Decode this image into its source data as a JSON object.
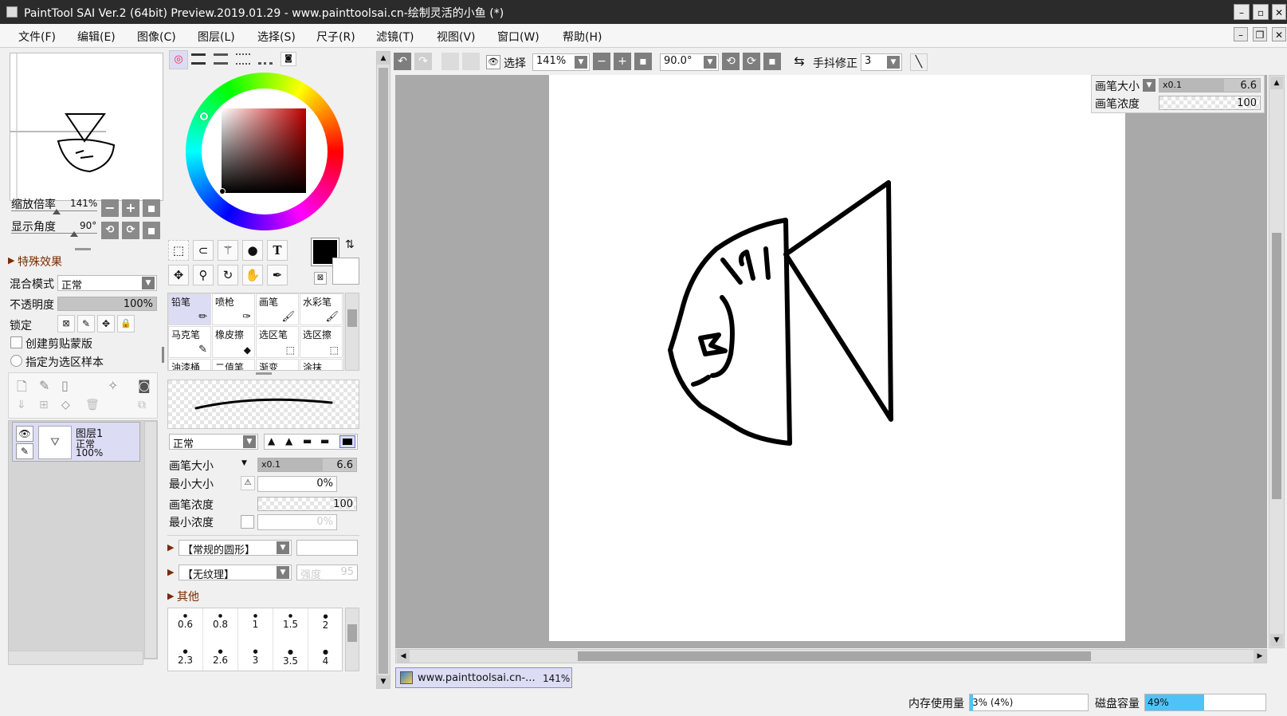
{
  "window": {
    "title": "PaintTool SAI Ver.2 (64bit) Preview.2019.01.29 - www.painttoolsai.cn-绘制灵活的小鱼 (*)"
  },
  "menu": [
    "文件(F)",
    "编辑(E)",
    "图像(C)",
    "图层(L)",
    "选择(S)",
    "尺子(R)",
    "滤镜(T)",
    "视图(V)",
    "窗口(W)",
    "帮助(H)"
  ],
  "navigator": {
    "zoom_label": "缩放倍率",
    "zoom_value": "141%",
    "angle_label": "显示角度",
    "angle_value": "90°"
  },
  "layer_props": {
    "effects_label": "特殊效果",
    "blend_label": "混合模式",
    "blend_value": "正常",
    "opacity_label": "不透明度",
    "opacity_value": "100%",
    "opacity_fraction": 1.0,
    "lock_label": "锁定",
    "clip_label": "创建剪贴蒙版",
    "sample_label": "指定为选区样本"
  },
  "layers": [
    {
      "name": "图层1",
      "mode": "正常",
      "opacity": "100%"
    }
  ],
  "tools": {
    "brushes_row1": [
      "铅笔",
      "喷枪",
      "画笔",
      "水彩笔"
    ],
    "brushes_row2": [
      "马克笔",
      "橡皮擦",
      "选区笔",
      "选区擦"
    ],
    "brushes_row3": [
      "油漆桶",
      "二值笔",
      "渐变",
      "涂抹"
    ],
    "text_tool_glyph": "T"
  },
  "brush_settings": {
    "mode_value": "正常",
    "size_label": "画笔大小",
    "size_mult": "x0.1",
    "size_value": "6.6",
    "min_size_label": "最小大小",
    "min_size_value": "0%",
    "density_label": "画笔浓度",
    "density_value": "100",
    "min_density_label": "最小浓度",
    "min_density_value": "0%",
    "shape_value": "【常规的圆形】",
    "texture_value": "【无纹理】",
    "texture_strength_label": "强度",
    "texture_strength_value": "95",
    "other_label": "其他",
    "size_presets_row1": [
      "0.6",
      "0.8",
      "1",
      "1.5",
      "2"
    ],
    "size_presets_row2": [
      "2.3",
      "2.6",
      "3",
      "3.5",
      "4"
    ]
  },
  "canvas_toolbar": {
    "select_label": "选择",
    "zoom_value": "141%",
    "rotation_value": "90.0°",
    "stabilizer_label": "手抖修正",
    "stabilizer_value": "3"
  },
  "canvas_overlay": {
    "size_label": "画笔大小",
    "size_mult": "x0.1",
    "size_value": "6.6",
    "density_label": "画笔浓度",
    "density_value": "100"
  },
  "document_tab": {
    "name": "www.painttoolsai.cn-...",
    "zoom": "141%"
  },
  "status": {
    "memory_label": "内存使用量",
    "memory_value": "3% (4%)",
    "memory_fraction": 0.03,
    "disk_label": "磁盘容量",
    "disk_value": "49%",
    "disk_fraction": 0.49
  },
  "colors": {
    "accent": "#4fc3f7",
    "selection": "#dcdcf5",
    "titlebar": "#2b2b2b",
    "primary_color": "#000000",
    "secondary_color": "#ffffff"
  }
}
